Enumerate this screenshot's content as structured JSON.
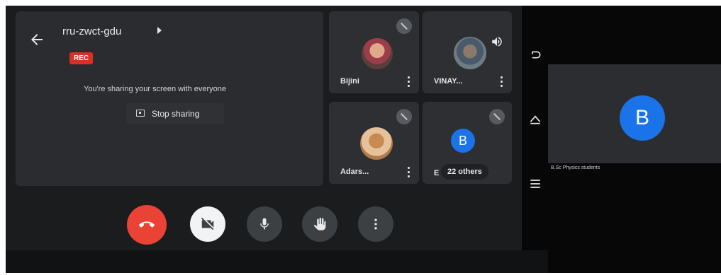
{
  "meeting": {
    "code": "rru-zwct-gdu",
    "rec_badge": "REC",
    "share_message": "You're sharing your screen with everyone",
    "stop_sharing_label": "Stop sharing"
  },
  "participants": [
    {
      "name": "Bijini",
      "avatar": "photo",
      "muted": true
    },
    {
      "name": "VINAY...",
      "avatar": "photo",
      "muted": false,
      "speaking": true
    },
    {
      "name": "Adars...",
      "avatar": "photo",
      "muted": true
    },
    {
      "name": "E",
      "avatar_letter": "B",
      "others_label": "22 others",
      "muted": true
    }
  ],
  "controls": [
    {
      "name": "end-call",
      "icon": "phone-hangup-icon",
      "color": "#ea4335"
    },
    {
      "name": "camera",
      "icon": "camera-off-icon",
      "color": "#f1f3f4"
    },
    {
      "name": "microphone",
      "icon": "mic-icon"
    },
    {
      "name": "raise-hand",
      "icon": "hand-icon"
    },
    {
      "name": "more-options",
      "icon": "more-vertical-icon"
    }
  ],
  "navbar": {
    "icons": [
      "back-nav-icon",
      "home-nav-icon",
      "recents-nav-icon"
    ]
  },
  "side_panel": {
    "avatar_letter": "B",
    "name": "B.Sc Physics students"
  },
  "colors": {
    "accent_blue": "#1a73e8",
    "end_call_red": "#ea4335",
    "rec_red": "#d93025"
  }
}
